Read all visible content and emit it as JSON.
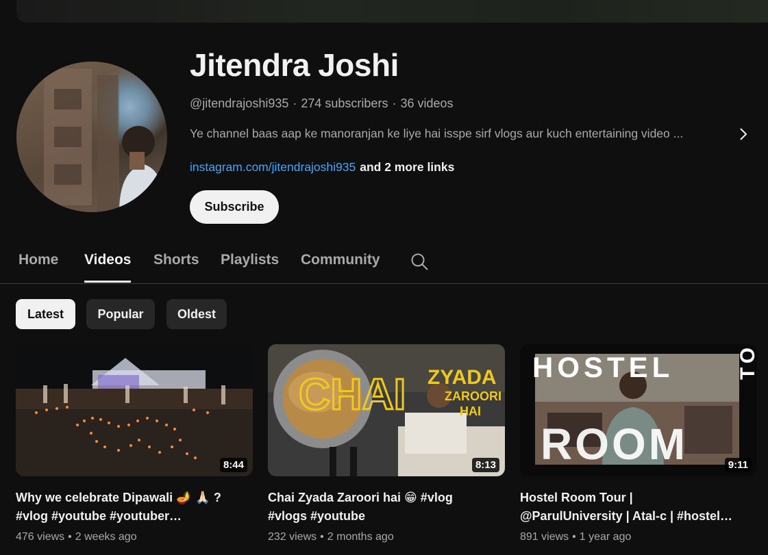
{
  "channel": {
    "name": "Jitendra Joshi",
    "handle": "@jitendrajoshi935",
    "subscribers": "274 subscribers",
    "video_count": "36 videos",
    "separator": "·",
    "description": "Ye channel baas aap ke manoranjan ke liye hai isspe sirf vlogs aur kuch entertaining video ...",
    "link": "instagram.com/jitendrajoshi935",
    "more_links": "and 2 more links",
    "subscribe_label": "Subscribe"
  },
  "tabs": [
    {
      "label": "Home",
      "active": false
    },
    {
      "label": "Videos",
      "active": true
    },
    {
      "label": "Shorts",
      "active": false
    },
    {
      "label": "Playlists",
      "active": false
    },
    {
      "label": "Community",
      "active": false
    }
  ],
  "filters": [
    {
      "label": "Latest",
      "active": true
    },
    {
      "label": "Popular",
      "active": false
    },
    {
      "label": "Oldest",
      "active": false
    }
  ],
  "videos": [
    {
      "title_line1": "Why we celebrate Dipawali 🪔 🙏🏻 ?",
      "title_line2": "#vlog #youtube #youtuber…",
      "duration": "8:44",
      "views": "476 views",
      "age": "2 weeks ago"
    },
    {
      "title_line1": "Chai Zyada Zaroori hai 😁 #vlog",
      "title_line2": "#vlogs #youtube",
      "duration": "8:13",
      "views": "232 views",
      "age": "2 months ago",
      "thumb_text": {
        "chai": "CHAI",
        "zyada": "ZYADA",
        "zaroori": "ZAROORI",
        "hai": "HAI"
      }
    },
    {
      "title_line1": "Hostel Room Tour |",
      "title_line2": "@ParulUniversity | Atal-c | #hostel…",
      "duration": "9:11",
      "views": "891 views",
      "age": "1 year ago",
      "thumb_text": {
        "hostel": "HOSTEL",
        "room": "ROOM",
        "tour": "TOUR"
      }
    }
  ],
  "stats_dot": "•",
  "colors": {
    "background": "#0f0f0f",
    "link": "#3ea6ff",
    "muted": "#aaaaaa",
    "chip": "#272727"
  }
}
